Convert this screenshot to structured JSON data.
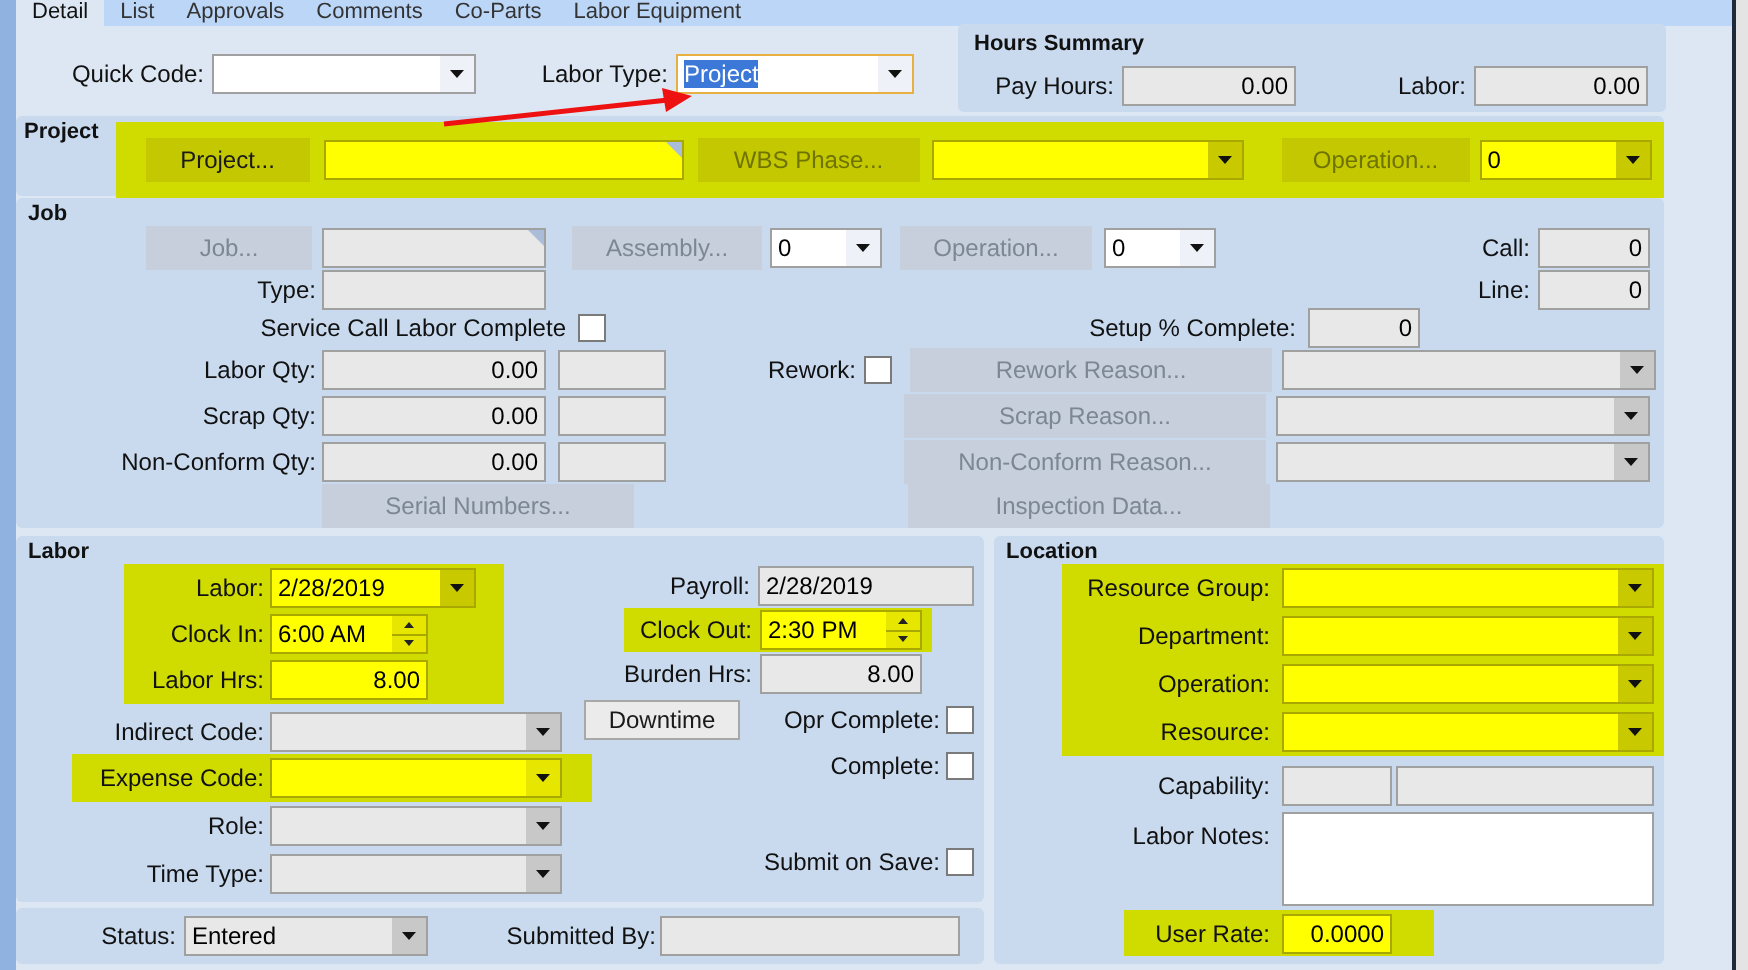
{
  "tabs": [
    {
      "label": "Detail",
      "selected": true
    },
    {
      "label": "List",
      "selected": false
    },
    {
      "label": "Approvals",
      "selected": false
    },
    {
      "label": "Comments",
      "selected": false
    },
    {
      "label": "Co-Parts",
      "selected": false
    },
    {
      "label": "Labor Equipment",
      "selected": false
    }
  ],
  "header": {
    "quick_code": {
      "label": "Quick Code:"
    },
    "labor_type": {
      "label": "Labor Type:",
      "value": "Project",
      "text_selected": true
    }
  },
  "hours_summary": {
    "title": "Hours Summary",
    "pay_hours": {
      "label": "Pay Hours:",
      "value": "0.00"
    },
    "labor": {
      "label": "Labor:",
      "value": "0.00"
    }
  },
  "project": {
    "title": "Project",
    "highlighted": true,
    "project_button": {
      "label": "Project...",
      "disabled": false
    },
    "wbs_button": {
      "label": "WBS Phase...",
      "disabled": true
    },
    "operation_button": {
      "label": "Operation...",
      "disabled": true
    },
    "operation_value": "0"
  },
  "job": {
    "title": "Job",
    "job_button": {
      "label": "Job...",
      "disabled": true
    },
    "assembly_button": {
      "label": "Assembly...",
      "disabled": true
    },
    "assembly_value": "0",
    "operation_button": {
      "label": "Operation...",
      "disabled": true
    },
    "operation_value": "0",
    "call": {
      "label": "Call:",
      "value": "0"
    },
    "type": {
      "label": "Type:"
    },
    "line": {
      "label": "Line:",
      "value": "0"
    },
    "service_call": {
      "label": "Service Call Labor Complete",
      "checked": false
    },
    "setup": {
      "label": "Setup % Complete:",
      "value": "0"
    },
    "qty_rows": [
      {
        "label": "Labor Qty:",
        "value": "0.00"
      },
      {
        "label": "Scrap Qty:",
        "value": "0.00"
      },
      {
        "label": "Non-Conform Qty:",
        "value": "0.00"
      }
    ],
    "rework": {
      "label": "Rework:",
      "checked": false
    },
    "reason_buttons": [
      {
        "label": "Rework Reason...",
        "disabled": true
      },
      {
        "label": "Scrap Reason...",
        "disabled": true
      },
      {
        "label": "Non-Conform Reason...",
        "disabled": true
      }
    ],
    "serial_button": {
      "label": "Serial Numbers...",
      "disabled": true
    },
    "inspection_button": {
      "label": "Inspection Data...",
      "disabled": true
    }
  },
  "labor": {
    "title": "Labor",
    "main_highlighted": true,
    "date": {
      "label": "Labor:",
      "value": "2/28/2019"
    },
    "clock_in": {
      "label": "Clock In:",
      "value": "6:00 AM"
    },
    "labor_hrs": {
      "label": "Labor Hrs:",
      "value": "8.00"
    },
    "indirect_code": {
      "label": "Indirect Code:"
    },
    "downtime_button": {
      "label": "Downtime",
      "disabled": false
    },
    "expense_code": {
      "label": "Expense Code:",
      "highlighted": true
    },
    "role": {
      "label": "Role:"
    },
    "time_type": {
      "label": "Time Type:"
    },
    "payroll": {
      "label": "Payroll:",
      "value": "2/28/2019"
    },
    "clock_out": {
      "label": "Clock Out:",
      "value": "2:30 PM",
      "highlighted": true
    },
    "burden_hrs": {
      "label": "Burden Hrs:",
      "value": "8.00"
    },
    "opr_complete": {
      "label": "Opr Complete:",
      "checked": false
    },
    "complete": {
      "label": "Complete:",
      "checked": false
    },
    "submit_on_save": {
      "label": "Submit on Save:",
      "checked": false
    }
  },
  "status_bar": {
    "status": {
      "label": "Status:",
      "value": "Entered"
    },
    "submitted_by": {
      "label": "Submitted By:"
    }
  },
  "location": {
    "title": "Location",
    "combos_highlighted": true,
    "combos": [
      {
        "label": "Resource Group:"
      },
      {
        "label": "Department:"
      },
      {
        "label": "Operation:"
      },
      {
        "label": "Resource:"
      }
    ],
    "capability": {
      "label": "Capability:"
    },
    "labor_notes": {
      "label": "Labor Notes:"
    },
    "user_rate": {
      "label": "User Rate:",
      "value": "0.0000",
      "highlighted": true
    }
  }
}
